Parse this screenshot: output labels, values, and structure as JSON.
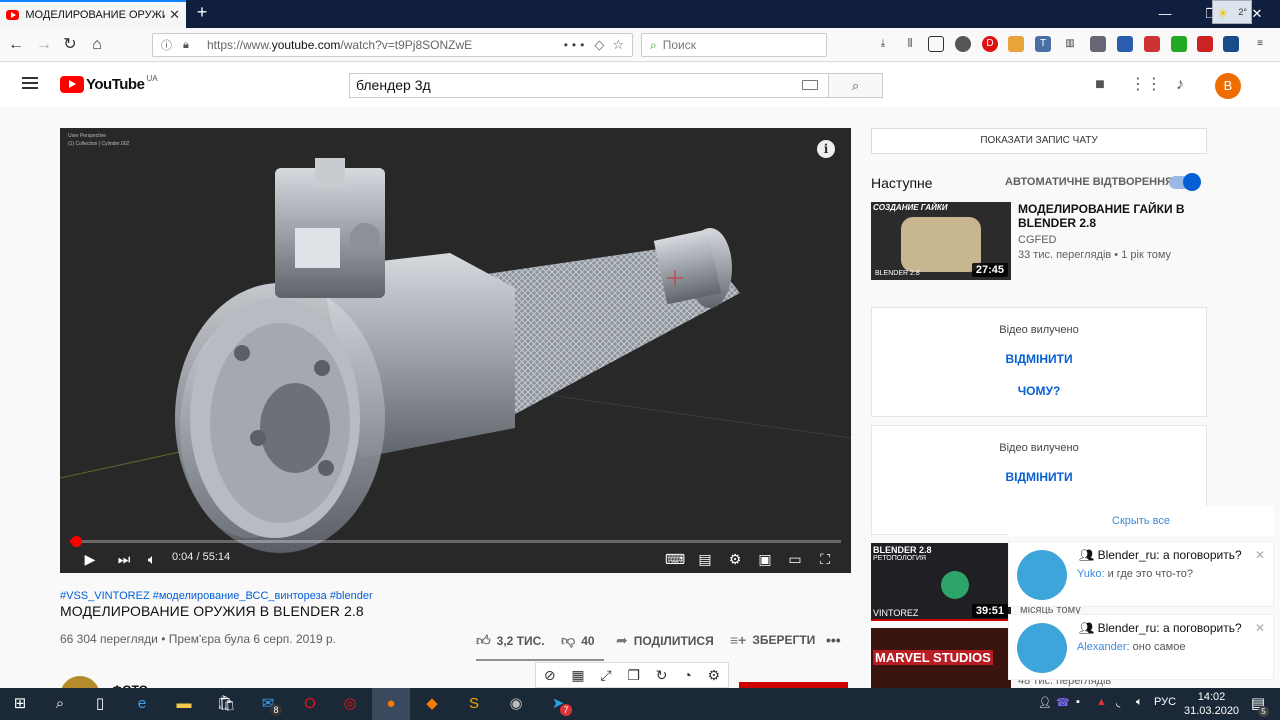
{
  "browser": {
    "tab_title": "МОДЕЛИРОВАНИЕ ОРУЖИЯ В",
    "tab_close": "✕",
    "new_tab": "+",
    "win_min": "—",
    "win_max": "❐",
    "win_close": "✕",
    "url_prefix": "https://www.",
    "url_domain": "youtube.com",
    "url_path": "/watch?v=t9Pj8SONZwE",
    "url_more": "•••",
    "search_placeholder": "Поиск",
    "weather_temp": "2°"
  },
  "youtube": {
    "logo_text": "YouTube",
    "logo_region": "UA",
    "search_value": "блендер 3д",
    "avatar_letter": "B"
  },
  "player": {
    "viewport_label": "User Perspective",
    "viewport_sub": "(1) Collection | Cylinder.002",
    "info": "i",
    "time": "0:04 / 55:14",
    "progress_fraction": 0.0012
  },
  "video": {
    "tags": "#VSS_VINTOREZ #моделирование_ВСС_винтореза #blender",
    "title": "МОДЕЛИРОВАНИЕ ОРУЖИЯ В BLENDER 2.8",
    "meta": "66 304 перегляди • Прем'єра була 6 серп. 2019 р.",
    "likes": "3,2 ТИС.",
    "dislikes": "40",
    "share": "ПОДІЛИТИСЯ",
    "save": "ЗБЕРЕГТИ",
    "more": "•••"
  },
  "sidebar": {
    "chat_button": "ПОКАЗАТИ ЗАПИС ЧАТУ",
    "next_label": "Наступне",
    "autoplay_label": "АВТОМАТИЧНЕ ВІДТВОРЕННЯ",
    "items": [
      {
        "title": "МОДЕЛИРОВАНИЕ ГАЙКИ В BLENDER 2.8",
        "channel": "CGFED",
        "meta": "33 тис. переглядів • 1 рік тому",
        "duration": "27:45",
        "thumb_caption": "СОЗДАНИЕ ГАЙКИ",
        "thumb_tag": "BLENDER 2.8"
      }
    ],
    "removed": [
      {
        "text": "Відео вилучено",
        "undo": "ВІДМІНИТИ",
        "why": "ЧОМУ?"
      },
      {
        "text": "Відео вилучено",
        "undo": "ВІДМІНИТИ"
      }
    ],
    "partial": [
      {
        "duration": "39:51",
        "thumb_top": "BLENDER 2.8",
        "thumb_sub": "РЕТОПОЛОГИЯ",
        "thumb_bottom": "VINTOREZ",
        "meta": "місяць тому"
      },
      {
        "thumb_text": "MARVEL STUDIOS",
        "meta": "48 тис. переглядів"
      }
    ]
  },
  "notifications": {
    "hide_all": "Скрыть все",
    "items": [
      {
        "title": "Blender_ru: а поговорить?",
        "who": "Yuko:",
        "msg": "и где это что-то?"
      },
      {
        "title": "Blender_ru: а поговорить?",
        "who": "Alexander:",
        "msg": "оно самое"
      }
    ]
  },
  "taskbar": {
    "lang": "РУС",
    "time": "14:02",
    "date": "31.03.2020",
    "mail_badge": "8",
    "telegram_badge": "7",
    "notif_badge": "5"
  },
  "channel_partial": "ФОТО"
}
